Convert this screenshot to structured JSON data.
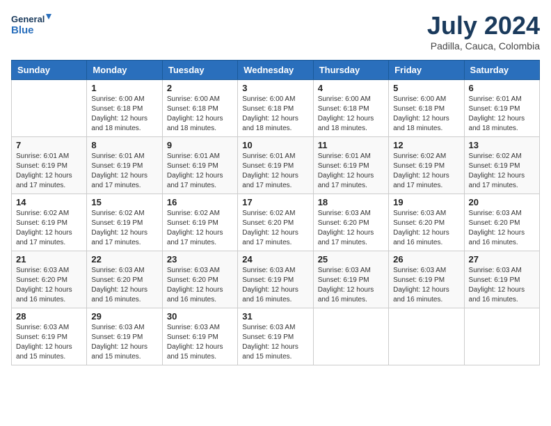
{
  "header": {
    "logo_line1": "General",
    "logo_line2": "Blue",
    "title": "July 2024",
    "subtitle": "Padilla, Cauca, Colombia"
  },
  "calendar": {
    "days_of_week": [
      "Sunday",
      "Monday",
      "Tuesday",
      "Wednesday",
      "Thursday",
      "Friday",
      "Saturday"
    ],
    "weeks": [
      [
        {
          "day": "",
          "info": ""
        },
        {
          "day": "1",
          "info": "Sunrise: 6:00 AM\nSunset: 6:18 PM\nDaylight: 12 hours\nand 18 minutes."
        },
        {
          "day": "2",
          "info": "Sunrise: 6:00 AM\nSunset: 6:18 PM\nDaylight: 12 hours\nand 18 minutes."
        },
        {
          "day": "3",
          "info": "Sunrise: 6:00 AM\nSunset: 6:18 PM\nDaylight: 12 hours\nand 18 minutes."
        },
        {
          "day": "4",
          "info": "Sunrise: 6:00 AM\nSunset: 6:18 PM\nDaylight: 12 hours\nand 18 minutes."
        },
        {
          "day": "5",
          "info": "Sunrise: 6:00 AM\nSunset: 6:18 PM\nDaylight: 12 hours\nand 18 minutes."
        },
        {
          "day": "6",
          "info": "Sunrise: 6:01 AM\nSunset: 6:19 PM\nDaylight: 12 hours\nand 18 minutes."
        }
      ],
      [
        {
          "day": "7",
          "info": ""
        },
        {
          "day": "8",
          "info": "Sunrise: 6:01 AM\nSunset: 6:19 PM\nDaylight: 12 hours\nand 17 minutes."
        },
        {
          "day": "9",
          "info": "Sunrise: 6:01 AM\nSunset: 6:19 PM\nDaylight: 12 hours\nand 17 minutes."
        },
        {
          "day": "10",
          "info": "Sunrise: 6:01 AM\nSunset: 6:19 PM\nDaylight: 12 hours\nand 17 minutes."
        },
        {
          "day": "11",
          "info": "Sunrise: 6:01 AM\nSunset: 6:19 PM\nDaylight: 12 hours\nand 17 minutes."
        },
        {
          "day": "12",
          "info": "Sunrise: 6:02 AM\nSunset: 6:19 PM\nDaylight: 12 hours\nand 17 minutes."
        },
        {
          "day": "13",
          "info": "Sunrise: 6:02 AM\nSunset: 6:19 PM\nDaylight: 12 hours\nand 17 minutes."
        }
      ],
      [
        {
          "day": "14",
          "info": ""
        },
        {
          "day": "15",
          "info": "Sunrise: 6:02 AM\nSunset: 6:19 PM\nDaylight: 12 hours\nand 17 minutes."
        },
        {
          "day": "16",
          "info": "Sunrise: 6:02 AM\nSunset: 6:19 PM\nDaylight: 12 hours\nand 17 minutes."
        },
        {
          "day": "17",
          "info": "Sunrise: 6:02 AM\nSunset: 6:20 PM\nDaylight: 12 hours\nand 17 minutes."
        },
        {
          "day": "18",
          "info": "Sunrise: 6:03 AM\nSunset: 6:20 PM\nDaylight: 12 hours\nand 17 minutes."
        },
        {
          "day": "19",
          "info": "Sunrise: 6:03 AM\nSunset: 6:20 PM\nDaylight: 12 hours\nand 16 minutes."
        },
        {
          "day": "20",
          "info": "Sunrise: 6:03 AM\nSunset: 6:20 PM\nDaylight: 12 hours\nand 16 minutes."
        }
      ],
      [
        {
          "day": "21",
          "info": ""
        },
        {
          "day": "22",
          "info": "Sunrise: 6:03 AM\nSunset: 6:20 PM\nDaylight: 12 hours\nand 16 minutes."
        },
        {
          "day": "23",
          "info": "Sunrise: 6:03 AM\nSunset: 6:20 PM\nDaylight: 12 hours\nand 16 minutes."
        },
        {
          "day": "24",
          "info": "Sunrise: 6:03 AM\nSunset: 6:19 PM\nDaylight: 12 hours\nand 16 minutes."
        },
        {
          "day": "25",
          "info": "Sunrise: 6:03 AM\nSunset: 6:19 PM\nDaylight: 12 hours\nand 16 minutes."
        },
        {
          "day": "26",
          "info": "Sunrise: 6:03 AM\nSunset: 6:19 PM\nDaylight: 12 hours\nand 16 minutes."
        },
        {
          "day": "27",
          "info": "Sunrise: 6:03 AM\nSunset: 6:19 PM\nDaylight: 12 hours\nand 16 minutes."
        }
      ],
      [
        {
          "day": "28",
          "info": ""
        },
        {
          "day": "29",
          "info": "Sunrise: 6:03 AM\nSunset: 6:19 PM\nDaylight: 12 hours\nand 15 minutes."
        },
        {
          "day": "30",
          "info": "Sunrise: 6:03 AM\nSunset: 6:19 PM\nDaylight: 12 hours\nand 15 minutes."
        },
        {
          "day": "31",
          "info": "Sunrise: 6:03 AM\nSunset: 6:19 PM\nDaylight: 12 hours\nand 15 minutes."
        },
        {
          "day": "",
          "info": ""
        },
        {
          "day": "",
          "info": ""
        },
        {
          "day": "",
          "info": ""
        }
      ]
    ],
    "week1_day7_info": "Sunrise: 6:01 AM\nSunset: 6:19 PM\nDaylight: 12 hours\nand 17 minutes.",
    "week2_day14_info": "Sunrise: 6:02 AM\nSunset: 6:19 PM\nDaylight: 12 hours\nand 17 minutes.",
    "week3_day21_info": "Sunrise: 6:03 AM\nSunset: 6:20 PM\nDaylight: 12 hours\nand 16 minutes.",
    "week4_day28_info": "Sunrise: 6:03 AM\nSunset: 6:19 PM\nDaylight: 12 hours\nand 15 minutes."
  }
}
